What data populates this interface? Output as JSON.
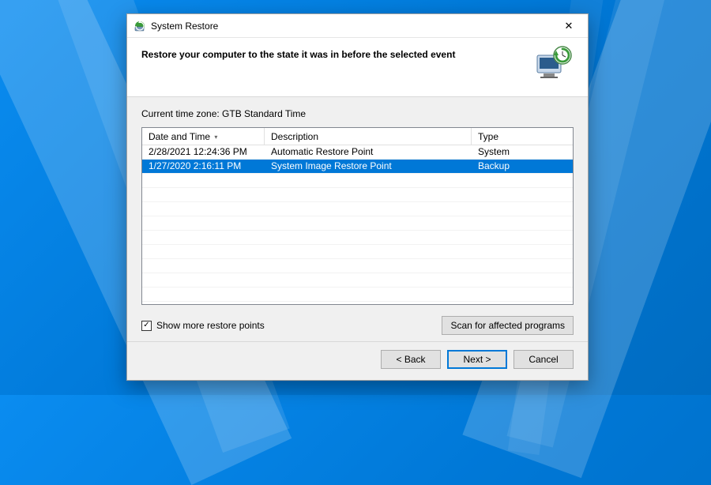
{
  "dialog": {
    "title": "System Restore",
    "close_label": "✕"
  },
  "header": {
    "heading": "Restore your computer to the state it was in before the selected event"
  },
  "body": {
    "timezone_label": "Current time zone: GTB Standard Time",
    "columns": {
      "date": "Date and Time",
      "desc": "Description",
      "type": "Type"
    },
    "rows": [
      {
        "date": "2/28/2021 12:24:36 PM",
        "desc": "Automatic Restore Point",
        "type": "System",
        "selected": false
      },
      {
        "date": "1/27/2020 2:16:11 PM",
        "desc": "System Image Restore Point",
        "type": "Backup",
        "selected": true
      }
    ],
    "checkbox": {
      "checked": true,
      "label": "Show more restore points"
    },
    "scan_button": "Scan for affected programs"
  },
  "footer": {
    "back": "< Back",
    "next": "Next >",
    "cancel": "Cancel"
  }
}
